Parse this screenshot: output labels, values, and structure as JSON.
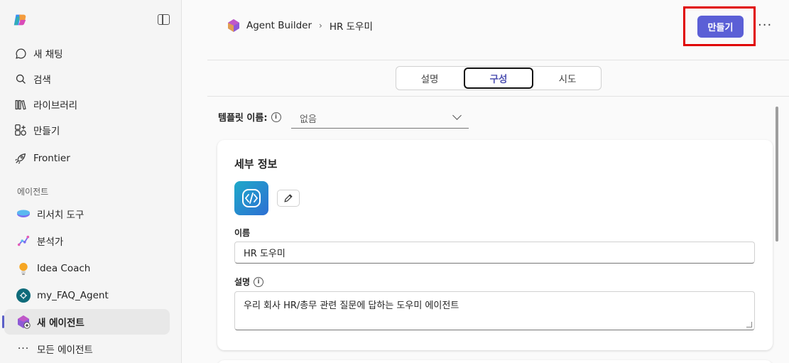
{
  "sidebar": {
    "nav": [
      {
        "label": "새 채팅",
        "icon": "chat-bubble-icon"
      },
      {
        "label": "검색",
        "icon": "search-icon"
      },
      {
        "label": "라이브러리",
        "icon": "library-icon"
      },
      {
        "label": "만들기",
        "icon": "create-icon"
      },
      {
        "label": "Frontier",
        "icon": "rocket-icon"
      }
    ],
    "section_label": "에이전트",
    "agents": [
      {
        "label": "리서치 도구"
      },
      {
        "label": "분석가"
      },
      {
        "label": "Idea Coach"
      },
      {
        "label": "my_FAQ_Agent"
      },
      {
        "label": "새 에이전트"
      },
      {
        "label": "모든 에이전트"
      }
    ]
  },
  "header": {
    "breadcrumb_root": "Agent Builder",
    "breadcrumb_current": "HR 도우미",
    "create_label": "만들기",
    "more_label": "···"
  },
  "tabs": [
    "설명",
    "구성",
    "시도"
  ],
  "template": {
    "label": "템플릿 이름:",
    "value": "없음"
  },
  "details": {
    "title": "세부 정보",
    "name_label": "이름",
    "name_value": "HR 도우미",
    "desc_label": "설명",
    "desc_value": "우리 회사 HR/총무 관련 질문에 답하는 도우미 에이전트"
  },
  "colors": {
    "accent": "#5b5fd6",
    "highlight": "#e00000"
  }
}
